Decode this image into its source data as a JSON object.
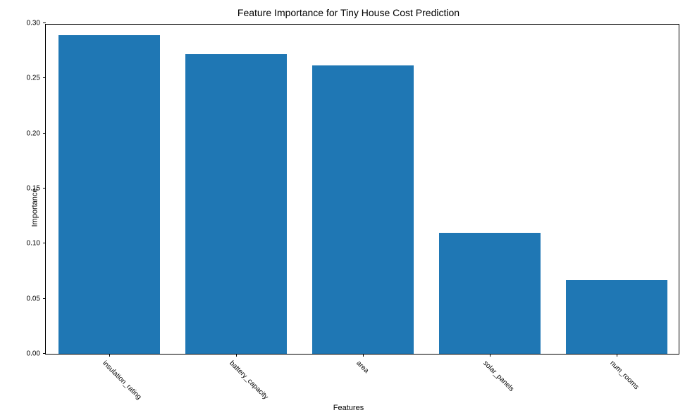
{
  "chart_data": {
    "type": "bar",
    "title": "Feature Importance for Tiny House Cost Prediction",
    "xlabel": "Features",
    "ylabel": "Importance",
    "categories": [
      "insulation_rating",
      "battery_capacity",
      "area",
      "solar_panels",
      "num_rooms"
    ],
    "values": [
      0.289,
      0.272,
      0.262,
      0.11,
      0.067
    ],
    "ylim": [
      0.0,
      0.3
    ],
    "yticks": [
      0.0,
      0.05,
      0.1,
      0.15,
      0.2,
      0.25,
      0.3
    ],
    "ytick_labels": [
      "0.00",
      "0.05",
      "0.10",
      "0.15",
      "0.20",
      "0.25",
      "0.30"
    ],
    "bar_color": "#1f77b4"
  }
}
